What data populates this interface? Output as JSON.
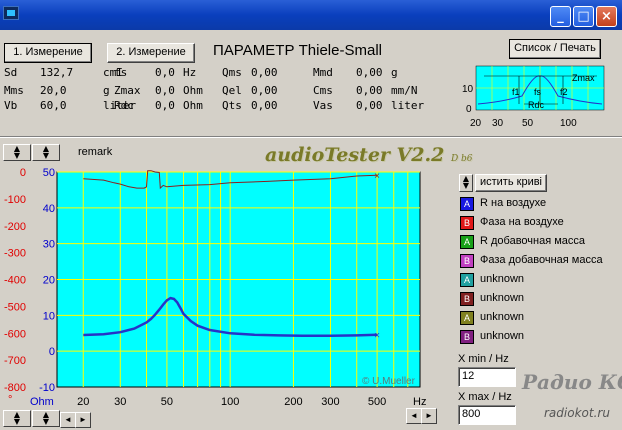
{
  "colors": {
    "plot_bg": "#00ffff",
    "grid": "#ffff00",
    "trace_impedance": "#2633c8",
    "trace_phase": "#8a2020",
    "axis_left": "#e00000",
    "axis_right": "#0000cc"
  },
  "toolbar": {
    "measure1": "1. Измерение",
    "measure2": "2. Измерение",
    "title": "ПАРАМЕТР Thiele-Small",
    "list_print": "Список / Печать"
  },
  "params": {
    "col1": [
      {
        "name": "Sd",
        "value": "132,7",
        "unit": "cmI"
      },
      {
        "name": "Mms",
        "value": "20,0",
        "unit": "g"
      },
      {
        "name": "Vb",
        "value": "60,0",
        "unit": "liter"
      }
    ],
    "col2": [
      {
        "name": "fs",
        "value": "0,0",
        "unit": "Hz"
      },
      {
        "name": "Zmax",
        "value": "0,0",
        "unit": "Ohm"
      },
      {
        "name": "Rdc",
        "value": "0,0",
        "unit": "Ohm"
      }
    ],
    "col3": [
      {
        "name": "Qms",
        "value": "0,00",
        "unit": ""
      },
      {
        "name": "Qel",
        "value": "0,00",
        "unit": ""
      },
      {
        "name": "Qts",
        "value": "0,00",
        "unit": ""
      }
    ],
    "col4": [
      {
        "name": "Mmd",
        "value": "0,00",
        "unit": "g"
      },
      {
        "name": "Cms",
        "value": "0,00",
        "unit": "mm/N"
      },
      {
        "name": "Vas",
        "value": "0,00",
        "unit": "liter"
      }
    ]
  },
  "mini_chart": {
    "labels": {
      "zmax": "Zmax",
      "f1": "f1",
      "fs": "fs",
      "f2": "f2",
      "rdc": "Rdc"
    },
    "y_ticks": [
      "10",
      "0"
    ],
    "x_ticks": [
      "20",
      "30",
      "50",
      "100"
    ]
  },
  "remark": "remark",
  "app_logo": "audioTester V2.2",
  "app_logo_build": "D b6",
  "clear_button": "истить криві",
  "legend": [
    {
      "letter": "A",
      "color": "#1818e0",
      "label": "R на воздухе"
    },
    {
      "letter": "B",
      "color": "#e01818",
      "label": "Фаза на воздухе"
    },
    {
      "letter": "A",
      "color": "#18a018",
      "label": "R добавочная масса"
    },
    {
      "letter": "B",
      "color": "#c040c0",
      "label": "Фаза добавочная масса"
    },
    {
      "letter": "A",
      "color": "#20a0a0",
      "label": "unknown"
    },
    {
      "letter": "B",
      "color": "#802020",
      "label": "unknown"
    },
    {
      "letter": "A",
      "color": "#808020",
      "label": "unknown"
    },
    {
      "letter": "B",
      "color": "#802080",
      "label": "unknown"
    }
  ],
  "xmin": {
    "label": "X min / Hz",
    "value": "12"
  },
  "xmax": {
    "label": "X max / Hz",
    "value": "800"
  },
  "watermark": {
    "main": "Радио КОТ",
    "sub": "radiokot.ru"
  },
  "chart_data": {
    "type": "line",
    "x_scale": "log",
    "xlim": [
      15,
      800
    ],
    "x_ticks": [
      "20",
      "30",
      "50",
      "100",
      "200",
      "300",
      "500"
    ],
    "xlabel": "Hz",
    "y_left_label": "°",
    "y_left_ticks": [
      "0",
      "-100",
      "-200",
      "-300",
      "-400",
      "-500",
      "-600",
      "-700",
      "-800"
    ],
    "y_right_label": "Ohm",
    "y_right_ticks": [
      "50",
      "40",
      "30",
      "20",
      "10",
      "0",
      "-10"
    ],
    "ylim_right": [
      -10,
      50
    ],
    "ylim_left": [
      -800,
      0
    ],
    "annotation": "© U.Mueller",
    "series": [
      {
        "axis": "right",
        "x": [
          20,
          25,
          30,
          35,
          40,
          42,
          44,
          46,
          48,
          50,
          52,
          54,
          56,
          58,
          60,
          65,
          70,
          80,
          100,
          130,
          170,
          220,
          300,
          400,
          500
        ],
        "y": [
          4.5,
          4.7,
          5.3,
          6.3,
          8.0,
          9.0,
          10.2,
          11.6,
          13.0,
          14.2,
          14.8,
          14.6,
          13.6,
          12.0,
          10.4,
          8.4,
          7.1,
          5.9,
          5.0,
          4.6,
          4.4,
          4.3,
          4.3,
          4.4,
          4.6
        ]
      },
      {
        "axis": "left",
        "x": [
          20,
          25,
          28,
          30,
          33,
          36,
          39,
          40,
          40.5,
          42,
          44,
          46,
          46.5,
          48,
          50,
          60,
          80,
          100,
          150,
          200,
          300,
          400,
          500
        ],
        "y": [
          -25,
          -30,
          -40,
          -45,
          -55,
          -60,
          -60,
          -55,
          5,
          5,
          0,
          -2,
          -60,
          -50,
          -55,
          -50,
          -47,
          -40,
          -35,
          -30,
          -25,
          -15,
          -12
        ]
      }
    ]
  }
}
